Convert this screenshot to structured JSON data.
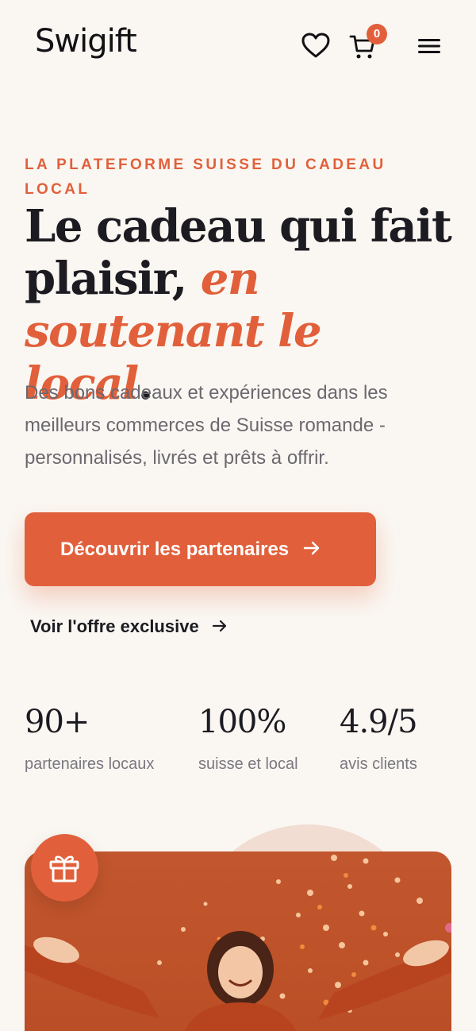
{
  "brand": {
    "name": "Swigift",
    "accent": "#e1603b"
  },
  "header": {
    "wishlist_icon": "heart-icon",
    "cart_icon": "cart-icon",
    "cart_count": "0",
    "menu_icon": "hamburger-menu-icon"
  },
  "hero": {
    "eyebrow": "La plateforme suisse du cadeau local",
    "headline_part1": "Le cadeau qui fait plaisir, ",
    "headline_accent": "en soutenant le local",
    "headline_end": ".",
    "subtitle": "Des bons cadeaux et expériences dans les meilleurs commerces de Suisse romande - personnalisés, livrés et prêts à offrir.",
    "cta_label": "Découvrir les partenaires",
    "secondary_label": "Voir l'offre exclusive"
  },
  "stats": [
    {
      "value": "90+",
      "label": "partenaires locaux"
    },
    {
      "value": "100%",
      "label": "suisse et local"
    },
    {
      "value": "4.9/5",
      "label": "avis clients"
    }
  ],
  "media": {
    "badge_icon": "gift-icon"
  }
}
